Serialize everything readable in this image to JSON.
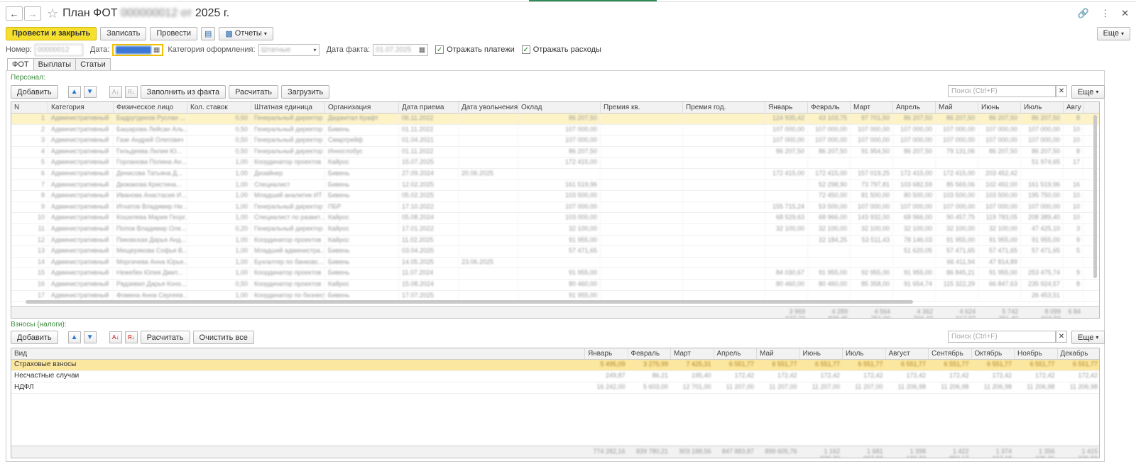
{
  "window": {
    "title": "План ФОТ",
    "title_blur": "000000012 от",
    "title_year": "2025 г."
  },
  "toolbar": {
    "post_close": "Провести и закрыть",
    "save": "Записать",
    "post": "Провести",
    "reports": "Отчеты",
    "more": "Еще"
  },
  "fields": {
    "number_label": "Номер:",
    "number_value": "00000012",
    "date_label": "Дата:",
    "date_value": "01.07.2025",
    "category_label": "Категория оформления:",
    "category_value": "Штатные",
    "fact_date_label": "Дата факта:",
    "fact_date_value": "01.07.2025",
    "show_payments": "Отражать платежи",
    "show_expenses": "Отражать расходы"
  },
  "tabs": [
    "ФОТ",
    "Выплаты",
    "Статьи"
  ],
  "staff": {
    "section": "Персонал:",
    "add": "Добавить",
    "fill_fact": "Заполнить из факта",
    "calc": "Расчитать",
    "load": "Загрузить",
    "search_placeholder": "Поиск (Ctrl+F)",
    "more": "Еще",
    "columns": [
      "N",
      "Категория",
      "Физическое лицо",
      "Кол. ставок",
      "Штатная единица",
      "Организация",
      "Дата приема",
      "Дата увольнения",
      "Оклад",
      "Премия кв.",
      "Премия год.",
      "Январь",
      "Февраль",
      "Март",
      "Апрель",
      "Май",
      "Июнь",
      "Июль",
      "Авгу"
    ],
    "rows": [
      [
        "1",
        "Административный",
        "Бадрутдинов Руслан ...",
        "0,50",
        "Генеральный директор",
        "Диджитал Крафт",
        "06.11.2022",
        "",
        "86 207,50",
        "",
        "",
        "124 935,42",
        "43 103,75",
        "97 701,50",
        "86 207,50",
        "86 207,50",
        "86 207,50",
        "86 207,50",
        "8"
      ],
      [
        "2",
        "Административный",
        "Башарова Лейсан Аль...",
        "0,50",
        "Генеральный директор",
        "Бивень",
        "01.11.2022",
        "",
        "107 000,00",
        "",
        "",
        "107 000,00",
        "107 000,00",
        "107 000,00",
        "107 000,00",
        "107 000,00",
        "107 000,00",
        "107 000,00",
        "10"
      ],
      [
        "3",
        "Административный",
        "Газе Андрей Олегович",
        "0,50",
        "Генеральный директор",
        "Смартрейф",
        "01.04.2021",
        "",
        "107 000,00",
        "",
        "",
        "107 000,00",
        "107 000,00",
        "107 000,00",
        "107 000,00",
        "107 000,00",
        "107 000,00",
        "107 000,00",
        "10"
      ],
      [
        "4",
        "Административный",
        "Гильдеева Лилия Ю...",
        "0,50",
        "Генеральный директор",
        "Инноглобус",
        "01.11.2022",
        "",
        "86 207,50",
        "",
        "",
        "86 207,50",
        "86 207,50",
        "91 954,50",
        "86 207,50",
        "79 131,06",
        "86 207,50",
        "86 207,50",
        "8"
      ],
      [
        "5",
        "Административный",
        "Горланова Полина Ан...",
        "1,00",
        "Координатор проектов",
        "Кайрос",
        "15.07.2025",
        "",
        "172 415,00",
        "",
        "",
        "",
        "",
        "",
        "",
        "",
        "",
        "51 974,65",
        "17"
      ],
      [
        "6",
        "Административный",
        "Денисова Татьяна Д...",
        "1,00",
        "Дизайнер",
        "Бивень",
        "27.09.2024",
        "20.06.2025",
        "",
        "",
        "",
        "172 415,00",
        "172 415,00",
        "157 019,25",
        "172 415,00",
        "172 415,00",
        "203 452,42",
        "",
        ""
      ],
      [
        "7",
        "Административный",
        "Дюжакова Кристина...",
        "1,00",
        "Специалист",
        "Бивень",
        "12.02.2025",
        "",
        "161 519,96",
        "",
        "",
        "",
        "52 298,90",
        "73 797,81",
        "103 682,59",
        "85 569,06",
        "102 492,00",
        "161 519,96",
        "16"
      ],
      [
        "8",
        "Административный",
        "Иванова Анастасия И...",
        "1,00",
        "Младший аналитик ИТ",
        "Бивень",
        "05.02.2025",
        "",
        "103 500,00",
        "",
        "",
        "",
        "72 450,00",
        "81 500,00",
        "80 500,00",
        "103 500,00",
        "103 500,00",
        "195 750,00",
        "10"
      ],
      [
        "9",
        "Административный",
        "Игнатов Владимир Ни...",
        "1,00",
        "Генеральный директор",
        "ПБР",
        "17.10.2022",
        "",
        "107 000,00",
        "",
        "",
        "155 715,24",
        "53 500,00",
        "107 000,00",
        "107 000,00",
        "107 000,00",
        "107 000,00",
        "107 000,00",
        "10"
      ],
      [
        "10",
        "Административный",
        "Кошелева Мария Георг...",
        "1,00",
        "Специалист по развит...",
        "Кайрос",
        "05.08.2024",
        "",
        "103 000,00",
        "",
        "",
        "68 529,63",
        "68 966,00",
        "143 932,00",
        "68 966,00",
        "90 457,75",
        "119 783,05",
        "208 389,40",
        "10"
      ],
      [
        "11",
        "Административный",
        "Попов Владимир Оле...",
        "0,20",
        "Генеральный директор",
        "Кайрос",
        "17.01.2022",
        "",
        "32 100,00",
        "",
        "",
        "32 100,00",
        "32 100,00",
        "32 100,00",
        "32 100,00",
        "32 100,00",
        "32 100,00",
        "47 425,10",
        "3"
      ],
      [
        "12",
        "Административный",
        "Пиковская Дарья Анд...",
        "1,00",
        "Координатор проектов",
        "Кайрос",
        "11.02.2025",
        "",
        "91 955,00",
        "",
        "",
        "",
        "32 184,25",
        "53 511,43",
        "78 146,03",
        "91 955,00",
        "91 955,00",
        "91 955,00",
        "9"
      ],
      [
        "13",
        "Административный",
        "Мещерякова Софья В...",
        "1,00",
        "Младший администра...",
        "Бивень",
        "03.04.2025",
        "",
        "57 471,65",
        "",
        "",
        "",
        "",
        "",
        "51 620,05",
        "57 471,65",
        "57 471,65",
        "57 471,65",
        "5"
      ],
      [
        "14",
        "Административный",
        "Моргачева Анна Юрье...",
        "1,00",
        "Бухгалтер по банковс...",
        "Бивень",
        "14.05.2025",
        "23.06.2025",
        "",
        "",
        "",
        "",
        "",
        "",
        "",
        "66 411,94",
        "47 814,89",
        "",
        ""
      ],
      [
        "15",
        "Административный",
        "Нежебек Юлия Дмит...",
        "1,00",
        "Координатор проектов",
        "Бивень",
        "11.07.2024",
        "",
        "91 955,00",
        "",
        "",
        "84 030,67",
        "91 955,00",
        "92 955,00",
        "91 955,00",
        "86 845,21",
        "91 955,00",
        "253 475,74",
        "9"
      ],
      [
        "16",
        "Административный",
        "Радзивил Дарья Коно...",
        "0,50",
        "Координатор проектов",
        "Кайрос",
        "15.08.2024",
        "",
        "80 460,00",
        "",
        "",
        "80 460,00",
        "80 460,00",
        "85 358,00",
        "91 654,74",
        "115 322,29",
        "66 847,63",
        "235 924,57",
        "8"
      ],
      [
        "17",
        "Административный",
        "Фомина Анна Сергеев...",
        "1,00",
        "Координатор по бизнесу",
        "Бивень",
        "17.07.2025",
        "",
        "91 955,00",
        "",
        "",
        "",
        "",
        "",
        "",
        "",
        "",
        "26 453,51",
        ""
      ]
    ],
    "totals": [
      "",
      "",
      "",
      "",
      "",
      "",
      "",
      "",
      "",
      "",
      "",
      "3 969 627,23",
      "4 289 838,45",
      "4 564 751,00",
      "4 362 766,43",
      "4 624 617,97",
      "5 742 361,40",
      "8 099 604,59",
      "6 84"
    ]
  },
  "taxes": {
    "section": "Взносы (налоги):",
    "add": "Добавить",
    "calc": "Расчитать",
    "clear": "Очистить все",
    "search_placeholder": "Поиск (Ctrl+F)",
    "more": "Еще",
    "columns": [
      "Вид",
      "Январь",
      "Февраль",
      "Март",
      "Апрель",
      "Май",
      "Июнь",
      "Июль",
      "Август",
      "Сентябрь",
      "Октябрь",
      "Ноябрь",
      "Декабрь"
    ],
    "rows": [
      {
        "name": "Страховые взносы",
        "values": [
          "5 495,09",
          "3 275,99",
          "7 425,31",
          "6 551,77",
          "6 551,77",
          "6 551,77",
          "6 551,77",
          "6 551,77",
          "6 551,77",
          "6 551,77",
          "6 551,77",
          "6 551,77"
        ]
      },
      {
        "name": "Несчастные случаи",
        "values": [
          "249,87",
          "86,21",
          "195,40",
          "172,42",
          "172,42",
          "172,42",
          "172,42",
          "172,42",
          "172,42",
          "172,42",
          "172,42",
          "172,42"
        ]
      },
      {
        "name": "НДФЛ",
        "values": [
          "16 242,00",
          "5 603,00",
          "12 701,00",
          "11 207,00",
          "11 207,00",
          "11 207,00",
          "11 207,00",
          "11 206,98",
          "11 206,98",
          "11 206,98",
          "11 206,98",
          "11 206,98"
        ]
      }
    ],
    "totals": [
      "774 282,16",
      "839 780,21",
      "903 188,56",
      "847 883,87",
      "899 605,76",
      "1 162 930,30",
      "1 681 007,93",
      "1 398 190,32",
      "1 422 950,17",
      "1 374 167,18",
      "1 356 105,31",
      "1 415 226,59"
    ]
  }
}
